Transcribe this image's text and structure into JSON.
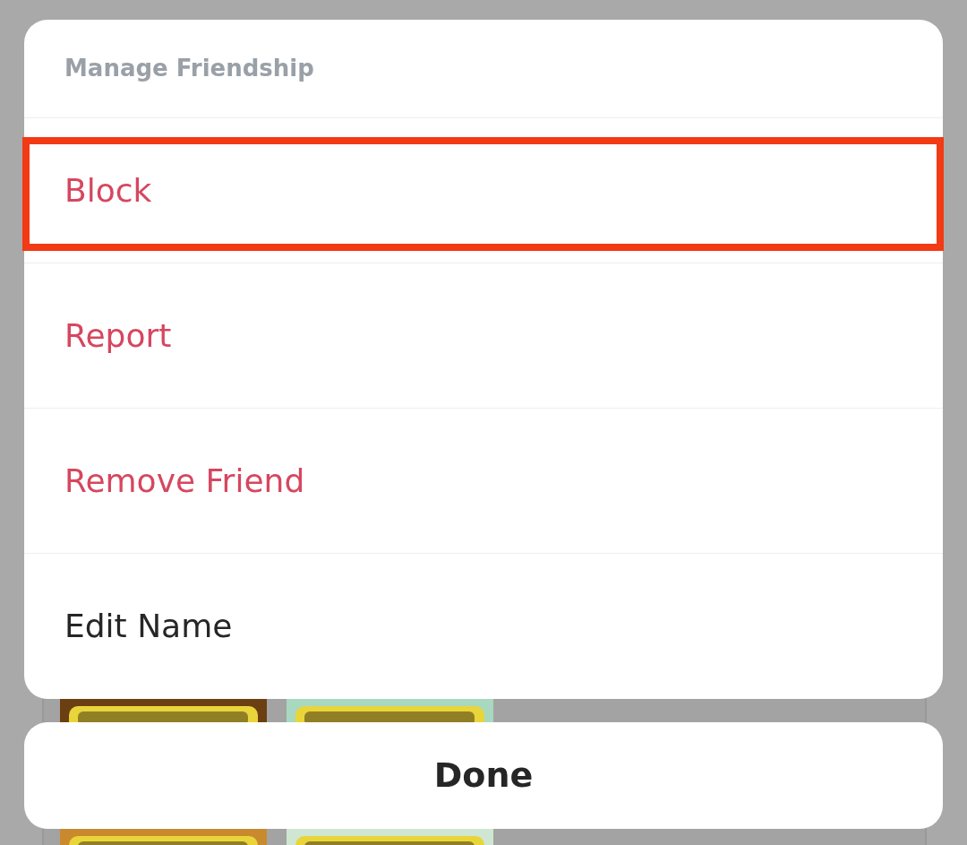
{
  "sheet": {
    "title": "Manage Friendship",
    "items": [
      {
        "label": "Block",
        "kind": "destructive",
        "highlighted": true
      },
      {
        "label": "Report",
        "kind": "destructive",
        "highlighted": false
      },
      {
        "label": "Remove Friend",
        "kind": "destructive",
        "highlighted": false
      },
      {
        "label": "Edit Name",
        "kind": "normal",
        "highlighted": false
      }
    ]
  },
  "done_button": {
    "label": "Done"
  }
}
